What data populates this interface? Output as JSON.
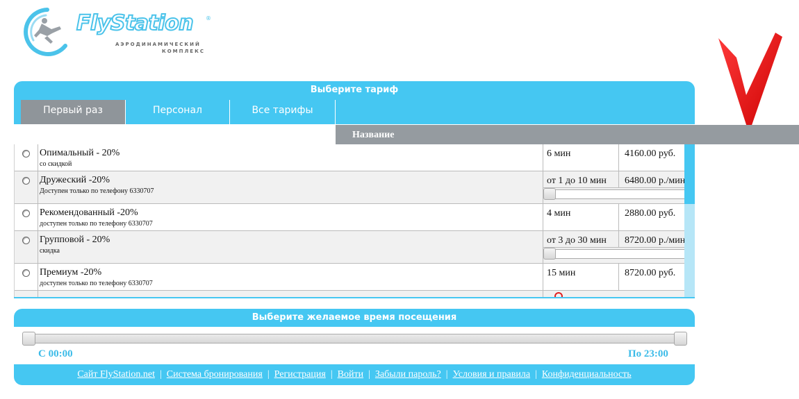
{
  "brand": {
    "name": "FlyStation",
    "reg_mark": "®",
    "subtitle_line1": "АЭРОДИНАМИЧЕСКИЙ",
    "subtitle_line2": "КОМПЛЕКС",
    "color": "#4bc3ea"
  },
  "tariff_panel": {
    "title": "Выберите тариф",
    "tabs": [
      {
        "label": "Первый раз",
        "active": true
      },
      {
        "label": "Персонал",
        "active": false
      },
      {
        "label": "Все тарифы",
        "active": false
      }
    ],
    "column_header": "Название",
    "rows": [
      {
        "name": "Опимальный - 20%",
        "note": "со скидкой",
        "duration": "6 мин",
        "price": "4160.00 руб."
      },
      {
        "name": "Дружеский -20%",
        "note": "Доступен только по телефону 6330707",
        "duration": "от 1 до 10 мин",
        "price": "6480.00 р./мин"
      },
      {
        "name": "Рекомендованный -20%",
        "note": "доступен только по телефону 6330707",
        "duration": "4 мин",
        "price": "2880.00 руб."
      },
      {
        "name": "Групповой - 20%",
        "note": "скидка",
        "duration": "от 3 до 30 мин",
        "price": "8720.00 р./мин"
      },
      {
        "name": "Премиум -20%",
        "note": "доступен только по телефону 6330707",
        "duration": "15 мин",
        "price": "8720.00 руб."
      }
    ]
  },
  "time_panel": {
    "title": "Выберите желаемое время посещения",
    "from_label": "С 00:00",
    "to_label": "По 23:00"
  },
  "footer": {
    "links": [
      "Сайт FlyStation.net",
      "Система бронирования",
      "Регистрация",
      "Войти",
      "Забыли пароль?",
      "Условия и правила",
      "Конфиденциальность"
    ],
    "separator": "|"
  },
  "colors": {
    "accent": "#45c7f2",
    "tab_active": "#8f959a",
    "header_gray": "#959ba0",
    "arrow": "#ff0000"
  }
}
